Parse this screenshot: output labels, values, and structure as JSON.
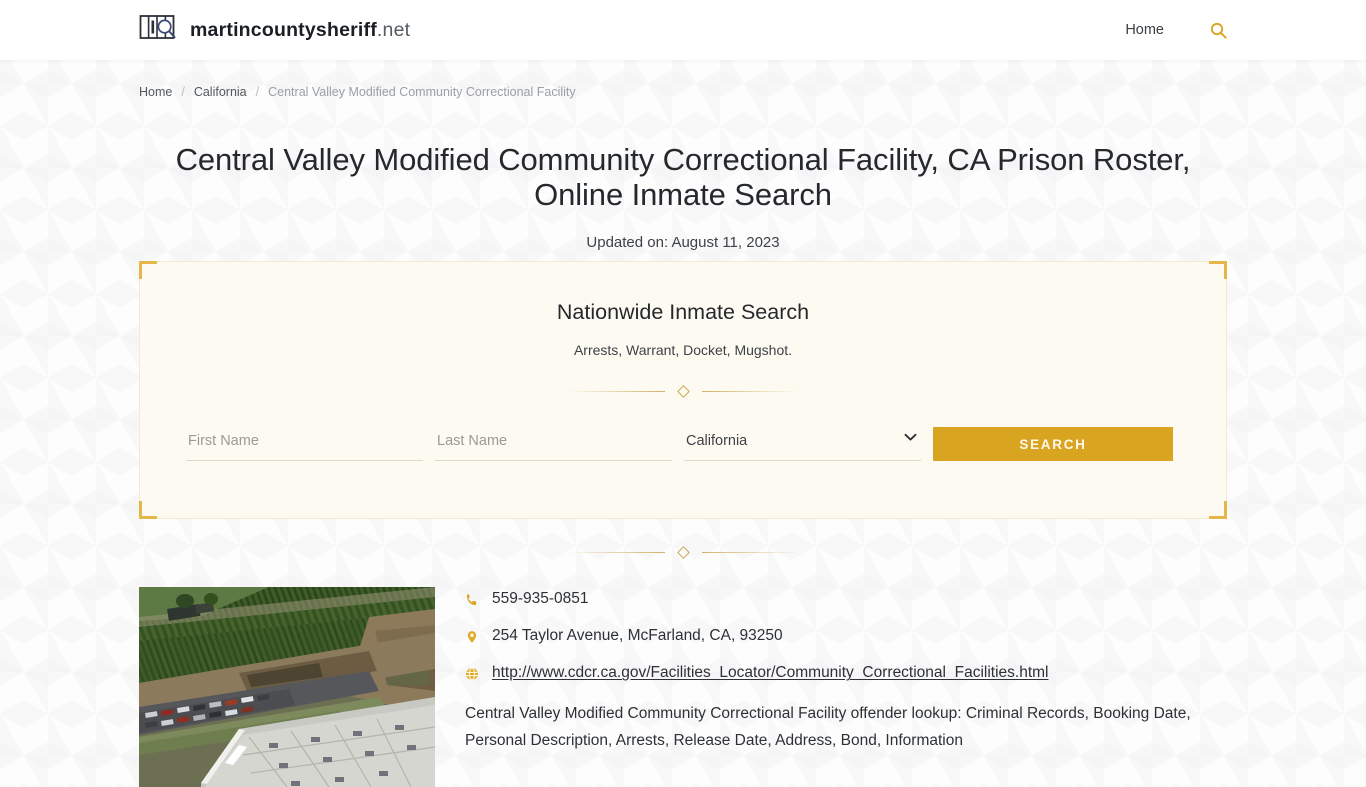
{
  "header": {
    "brand_bold": "martincountysheriff",
    "brand_light": ".net",
    "logo_icon": "jail-bars-magnifier-icon",
    "nav": [
      {
        "label": "Home",
        "icon": ""
      }
    ],
    "search_icon": "search-icon"
  },
  "breadcrumb": {
    "items": [
      {
        "label": "Home",
        "current": false
      },
      {
        "label": "California",
        "current": false
      },
      {
        "label": "Central Valley Modified Community Correctional Facility",
        "current": true
      }
    ],
    "separator": "/"
  },
  "main": {
    "title": "Central Valley Modified Community Correctional Facility, CA Prison Roster, Online Inmate Search",
    "updated_on": "Updated on: August 11, 2023"
  },
  "search_panel": {
    "title": "Nationwide Inmate Search",
    "subtitle": "Arrests, Warrant, Docket, Mugshot.",
    "first_name_placeholder": "First Name",
    "first_name_value": "",
    "last_name_placeholder": "Last Name",
    "last_name_value": "",
    "state_selected": "California",
    "state_options": [
      "California"
    ],
    "submit_label": "SEARCH",
    "submit_color": "#d9a520",
    "panel_bg": "#fdfbf1",
    "corner_accent_color": "#e3b748",
    "caret_icon": "chevron-down-icon"
  },
  "facility": {
    "photo_alt": "aerial-view-of-correctional-facility",
    "phone": "559-935-0851",
    "phone_icon": "phone-icon",
    "address": "254 Taylor Avenue, McFarland, CA, 93250",
    "address_icon": "map-pin-icon",
    "website": "http://www.cdcr.ca.gov/Facilities_Locator/Community_Correctional_Facilities.html",
    "website_icon": "globe-icon",
    "description": "Central Valley Modified Community Correctional Facility offender lookup: Criminal Records, Booking Date, Personal Description, Arrests, Release Date, Address, Bond, Information"
  },
  "ornament": {
    "gem_color": "#c8a74e"
  }
}
